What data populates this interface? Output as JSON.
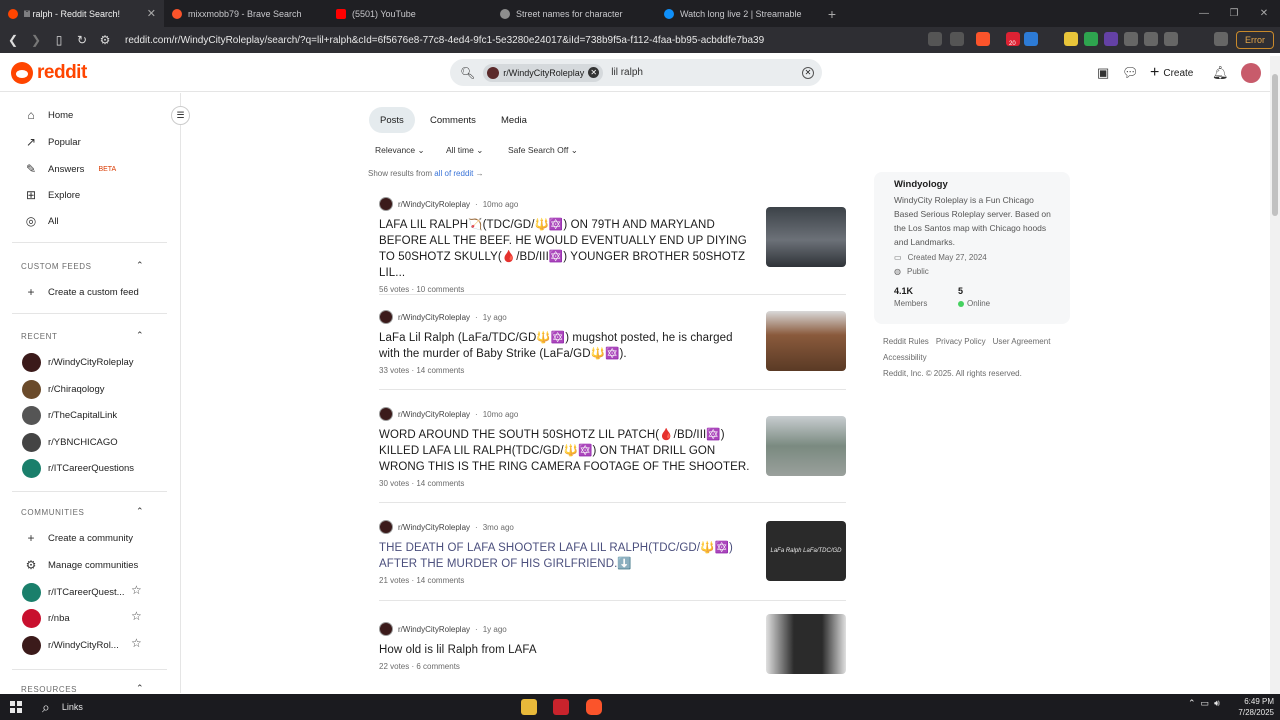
{
  "browser": {
    "tabs": [
      {
        "label": "lil ralph - Reddit Search!",
        "color": "#ff4500",
        "active": true
      },
      {
        "label": "mixxmobb79 - Brave Search",
        "color": "#fb542b"
      },
      {
        "label": "(5501) YouTube",
        "color": "#ff0000"
      },
      {
        "label": "Street names for character",
        "color": "#8e8e8e"
      },
      {
        "label": "Watch long live 2 | Streamable",
        "color": "#0f90fa"
      }
    ],
    "url": "reddit.com/r/WindyCityRoleplay/search/?q=lil+ralph&cId=6f5676e8-77c8-4ed4-9fc1-5e3280e24017&iId=738b9f5a-f112-4faa-bb95-acbddfe7ba39",
    "error_label": "Error",
    "badge_count": "20"
  },
  "header": {
    "logo_text": "reddit",
    "search_chip": "r/WindyCityRoleplay",
    "search_query": "lil ralph",
    "create_label": "Create"
  },
  "sidebar": {
    "nav": [
      {
        "label": "Home",
        "icon": "home-icon",
        "glyph": "⌂"
      },
      {
        "label": "Popular",
        "icon": "popular-icon",
        "glyph": "↗"
      },
      {
        "label": "Answers",
        "icon": "answers-icon",
        "glyph": "✎",
        "badge": "BETA"
      },
      {
        "label": "Explore",
        "icon": "explore-icon",
        "glyph": "⊞"
      },
      {
        "label": "All",
        "icon": "all-icon",
        "glyph": "◎"
      }
    ],
    "custom_feeds_title": "CUSTOM FEEDS",
    "create_feed": "Create a custom feed",
    "recent_title": "RECENT",
    "recent": [
      {
        "label": "r/WindyCityRoleplay",
        "color": "#3b1a1a"
      },
      {
        "label": "r/Chiraqology",
        "color": "#6a4a2a"
      },
      {
        "label": "r/TheCapitalLink",
        "color": "#555555"
      },
      {
        "label": "r/YBNCHICAGO",
        "color": "#444444"
      },
      {
        "label": "r/ITCareerQuestions",
        "color": "#1a7f6b"
      }
    ],
    "communities_title": "COMMUNITIES",
    "create_community": "Create a community",
    "manage_communities": "Manage communities",
    "communities": [
      {
        "label": "r/ITCareerQuest...",
        "color": "#1a7f6b"
      },
      {
        "label": "r/nba",
        "color": "#c8102e"
      },
      {
        "label": "r/WindyCityRol...",
        "color": "#3b1a1a"
      }
    ],
    "resources_title": "RESOURCES"
  },
  "main": {
    "tabs": [
      "Posts",
      "Comments",
      "Media"
    ],
    "filters": [
      "Relevance",
      "All time",
      "Safe Search Off"
    ],
    "show_results_prefix": "Show results from",
    "show_results_link": "all of reddit",
    "posts": [
      {
        "sub": "r/WindyCityRoleplay",
        "age": "10mo ago",
        "title": "LAFA LIL RALPH🏹(TDC/GD/🔱🔯) ON 79TH AND MARYLAND BEFORE ALL THE BEEF. HE WOULD EVENTUALLY END UP DIYING TO 50SHOTZ SKULLY(🩸/BD/III🔯) YOUNGER BROTHER 50SHOTZ LIL...",
        "votes": "56 votes",
        "comments": "10 comments",
        "thumb": "#4a4f55",
        "visited": false
      },
      {
        "sub": "r/WindyCityRoleplay",
        "age": "1y ago",
        "title": "LaFa Lil Ralph (LaFa/TDC/GD🔱🔯) mugshot posted, he is charged with the murder of Baby Strike (LaFa/GD🔱🔯).",
        "votes": "33 votes",
        "comments": "14 comments",
        "thumb": "#6b4a35",
        "visited": false
      },
      {
        "sub": "r/WindyCityRoleplay",
        "age": "10mo ago",
        "title": "WORD AROUND THE SOUTH 50SHOTZ LIL PATCH(🩸/BD/III🔯) KILLED LAFA LIL RALPH(TDC/GD/🔱🔯) ON THAT DRILL GON WRONG THIS IS THE RING CAMERA FOOTAGE OF THE SHOOTER.",
        "votes": "30 votes",
        "comments": "14 comments",
        "thumb": "#7a8a7a",
        "visited": false
      },
      {
        "sub": "r/WindyCityRoleplay",
        "age": "3mo ago",
        "title": "THE DEATH OF LAFA SHOOTER LAFA LIL RALPH(TDC/GD/🔱🔯) AFTER THE MURDER OF HIS GIRLFRIEND.⬇️",
        "votes": "21 votes",
        "comments": "14 comments",
        "thumb": "#2f2f2f",
        "thumb_text": "LaFa Ralph LaFa/TDC/GD",
        "visited": true
      },
      {
        "sub": "r/WindyCityRoleplay",
        "age": "1y ago",
        "title": "How old is lil Ralph from LAFA",
        "votes": "22 votes",
        "comments": "6 comments",
        "thumb": "#d8d8d8",
        "visited": false
      }
    ]
  },
  "community": {
    "name": "Windyology",
    "description": "WindyCity Roleplay is a Fun Chicago Based Serious Roleplay server. Based on the Los Santos map with Chicago hoods and Landmarks.",
    "created": "Created May 27, 2024",
    "visibility": "Public",
    "members_value": "4.1K",
    "members_label": "Members",
    "online_value": "5",
    "online_label": "Online"
  },
  "footer": {
    "links": [
      "Reddit Rules",
      "Privacy Policy",
      "User Agreement"
    ],
    "accessibility": "Accessibility",
    "copyright": "Reddit, Inc. © 2025. All rights reserved."
  },
  "taskbar": {
    "links_label": "Links",
    "time": "6:49 PM",
    "date": "7/28/2025"
  }
}
